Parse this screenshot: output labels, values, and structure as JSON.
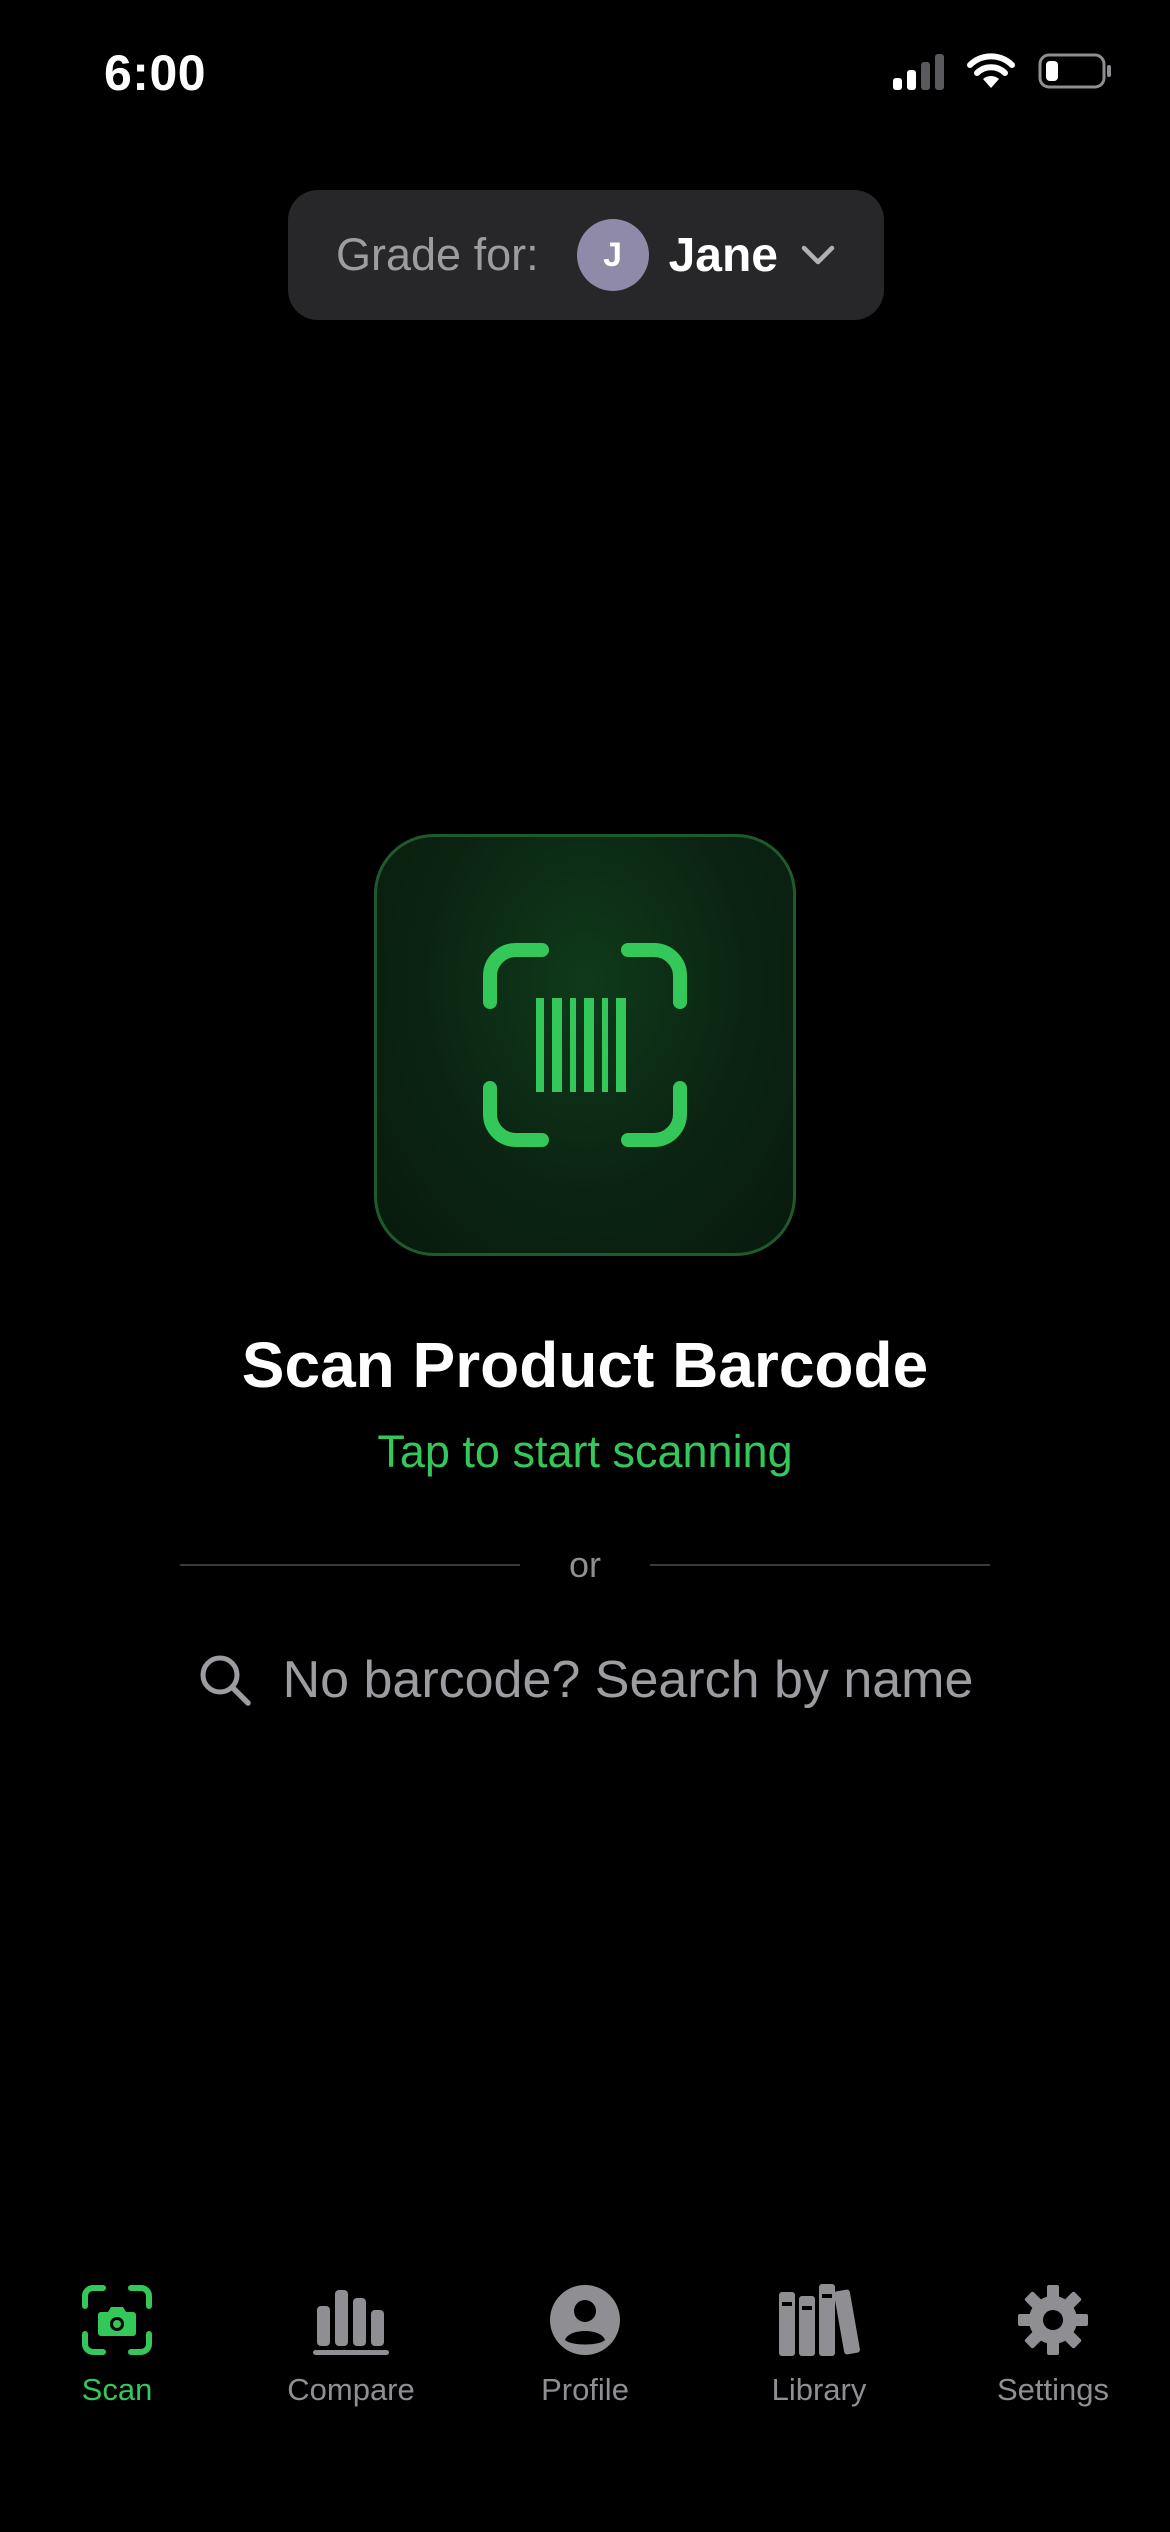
{
  "status_bar": {
    "time": "6:00"
  },
  "grade_selector": {
    "label": "Grade for:",
    "avatar_initial": "J",
    "name": "Jane"
  },
  "scan": {
    "icon": "barcode-scan-icon",
    "title": "Scan Product Barcode",
    "subtitle": "Tap to start scanning"
  },
  "divider": {
    "text": "or"
  },
  "search": {
    "icon": "search-icon",
    "placeholder": "No barcode? Search by name"
  },
  "tab_bar": {
    "items": [
      {
        "label": "Scan",
        "icon": "camera-scan-icon",
        "active": true
      },
      {
        "label": "Compare",
        "icon": "bar-chart-icon",
        "active": false
      },
      {
        "label": "Profile",
        "icon": "person-circle-icon",
        "active": false
      },
      {
        "label": "Library",
        "icon": "books-icon",
        "active": false
      },
      {
        "label": "Settings",
        "icon": "gear-icon",
        "active": false
      }
    ]
  },
  "colors": {
    "background": "#000000",
    "accent": "#34c759",
    "pill_background": "#272729",
    "secondary_text": "#8e8e93",
    "avatar": "#8e8aa8"
  }
}
